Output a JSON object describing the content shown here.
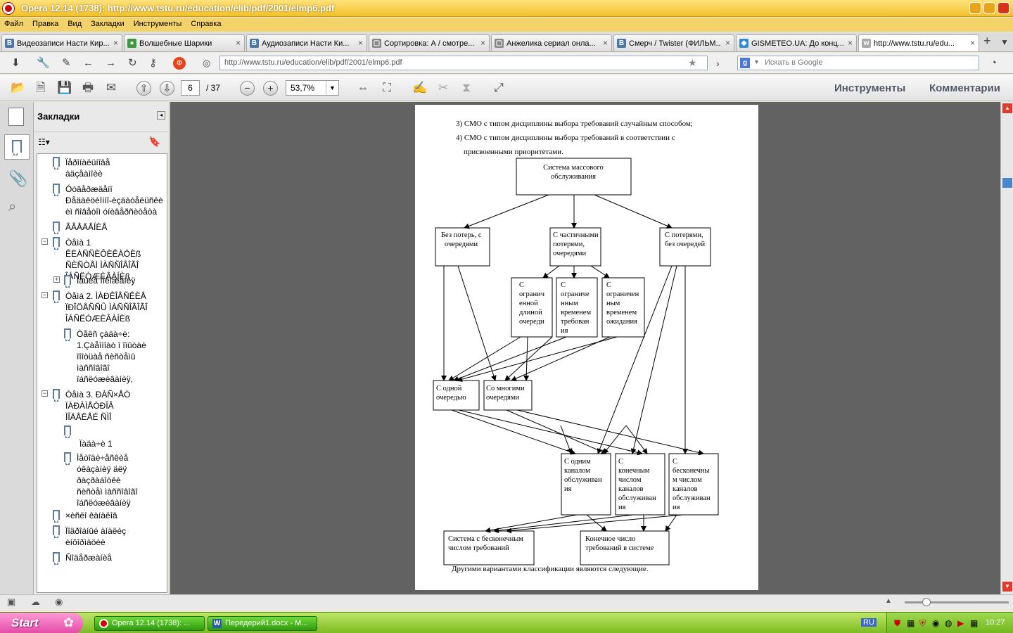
{
  "window": {
    "title": "Opera 12.14 (1738): http://www.tstu.ru/education/elib/pdf/2001/elmp6.pdf"
  },
  "menu": [
    "Файл",
    "Правка",
    "Вид",
    "Закладки",
    "Инструменты",
    "Справка"
  ],
  "tabs": [
    {
      "label": "Видеозаписи Насти Кир...",
      "icon": "В",
      "color": "#4a76a8"
    },
    {
      "label": "Волшебные Шарики",
      "icon": "●",
      "color": "#3a9a3a"
    },
    {
      "label": "Аудиозаписи Насти Ки...",
      "icon": "В",
      "color": "#4a76a8"
    },
    {
      "label": "Сортировка: А / смотре...",
      "icon": "▢",
      "color": "#888888"
    },
    {
      "label": "Анжелика сериал онла...",
      "icon": "▢",
      "color": "#888888"
    },
    {
      "label": "Смерч / Twister (ФИЛЬМ...",
      "icon": "В",
      "color": "#4a76a8"
    },
    {
      "label": "GISMETEO.UA: До конц...",
      "icon": "◆",
      "color": "#2f8ad8"
    },
    {
      "label": "http://www.tstu.ru/edu...",
      "icon": "w",
      "color": "#aaaaaa"
    }
  ],
  "address": {
    "url": "http://www.tstu.ru/education/elib/pdf/2001/elmp6.pdf",
    "search_placeholder": "Искать в Google"
  },
  "pdf": {
    "page": "6",
    "total": "/ 37",
    "zoom": "53,7%",
    "tools": "Инструменты",
    "comments": "Комментарии"
  },
  "bookmarks": {
    "title": "Закладки",
    "items": [
      "Ïåðîíàëüíîâå\nàäçåàìîèè",
      "Óòâåðæäåíî\nÐåäàêöèîííî-èçäàòåëüñêè\nèì ñîâåòîì óíèâåðñèòåòà",
      "ÂÂÅÄÅÍÈÅ",
      "Òåìà 1 ÊËÀÑÑÈÔÈÊÀÖÈß\nÑÈÑÒÅÌ ÌÀÑÑÎÂÎÃÎ\nÎÁÑËÓÆÈÂÀÍÈß",
      "Îáùèå ïîëîæåíèÿ",
      "Òåìà 2. ÌÀÐÊÎÂÑÊÈÅ\nÏÐÎÖÅÑÑÛ ÌÀÑÑÎÂÎÃÎ\nÎÁÑËÓÆÈÂÀÍÈß",
      "Òåêñ çàäà÷è:\n1.Çàåîìîàò î îïûòàè\nîîîòüàå ñèñòåìû\nìàññîâîãî\nîáñëóæèâàíèÿ,",
      "Òåìà 3. ÐÀÑ×ÅÒ\nÏÀÐÀÌÅÒÐÎÂ\nÌÎÄÅËÅÉ ÑÌÎ",
      "Ïàäà÷è 1",
      "Ìåòîäè÷åñêèå\nóêàçàíèÿ äëÿ\nðàçðàáîòêè\nñèñòåì ìàññîâîãî\nîáñëóæèâàíèÿ",
      "×èñëî êàíàëîâ",
      "Ïîäðîáíûé àíàëèç\nèíôîðìàöèè",
      "Ñîäåðæàíèå"
    ]
  },
  "document": {
    "line1": "3) СМО с типом дисциплины выбора  требований случайным способом;",
    "line2": "4) СМО   с   типом   дисциплины   выбора   требований   в   соответствии   с",
    "line3": "присвоенными приоритетами.",
    "footer": "Другими вариантами классификации являются следующие.",
    "boxes": {
      "root": [
        "Система массового",
        "обслуживания"
      ],
      "b1": [
        "Без потерь, с",
        "очередями"
      ],
      "b2": [
        "С частичными",
        "потерями,",
        "очередями"
      ],
      "b3": [
        "С потерями,",
        "без очередей"
      ],
      "c1": [
        "С",
        "огранич",
        "енной",
        "длиной",
        "очереди"
      ],
      "c2": [
        "С",
        "ограниче",
        "нным",
        "временем",
        "требован",
        "ия"
      ],
      "c3": [
        "С",
        "ограничен",
        "ным",
        "временем",
        "ожидания"
      ],
      "d1": [
        "С одной",
        "очередью"
      ],
      "d2": [
        "Со многими",
        "очередями"
      ],
      "e1": [
        "С  одним",
        "каналом",
        "обслуживан",
        "ия"
      ],
      "e2": [
        "С",
        "конечным",
        "числом",
        "каналов",
        "обслуживан",
        "ия"
      ],
      "e3": [
        "С",
        "бесконечны",
        "м числом",
        "каналов",
        "обслуживан",
        "ия"
      ],
      "f1": [
        "Система с бесконечным",
        "числом требований"
      ],
      "f2": [
        "Конечное число",
        "требований  в системе"
      ]
    }
  },
  "taskbar": {
    "start": "Start",
    "tasks": [
      "Opera 12.14 (1738): ...",
      "Передерий1.docx - М..."
    ],
    "lang": "RU",
    "clock": "10:27"
  }
}
